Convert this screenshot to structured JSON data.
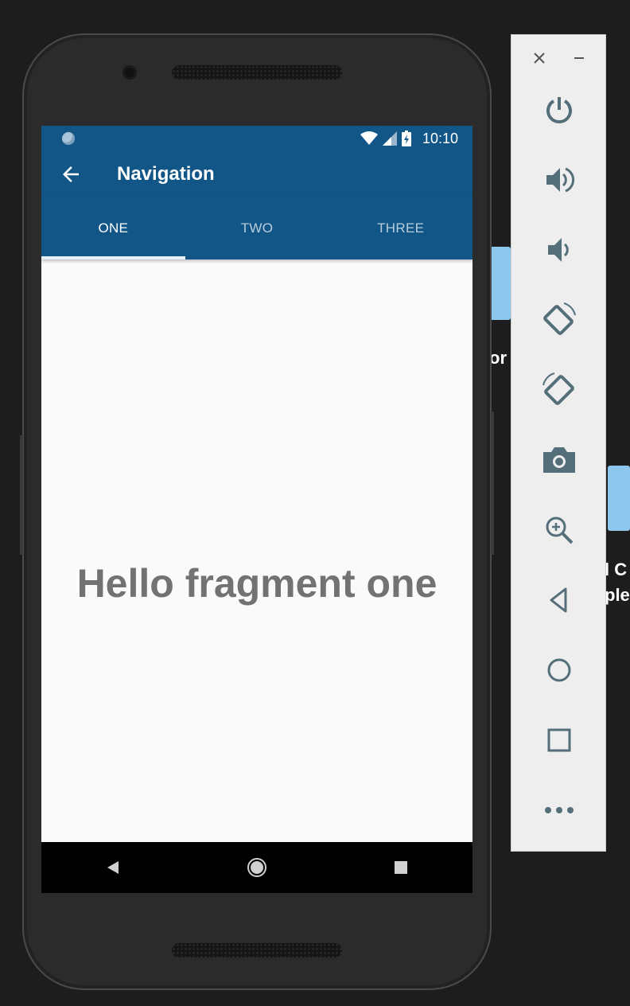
{
  "desktop": {
    "label_1": "or",
    "label_2_line1": "l C",
    "label_2_line2": "ple"
  },
  "status_bar": {
    "time": "10:10",
    "icons": [
      "wifi-icon",
      "signal-icon",
      "battery-charging-icon"
    ]
  },
  "app_bar": {
    "title": "Navigation",
    "back_icon": "arrow-back-icon"
  },
  "tabs": [
    {
      "label": "ONE",
      "selected": true
    },
    {
      "label": "TWO",
      "selected": false
    },
    {
      "label": "THREE",
      "selected": false
    }
  ],
  "content": {
    "text": "Hello fragment one"
  },
  "nav_bar": [
    "back-icon",
    "home-icon",
    "recents-icon"
  ],
  "emulator_toolbar": {
    "buttons": [
      "close-icon",
      "minimize-icon",
      "power-icon",
      "volume-up-icon",
      "volume-down-icon",
      "rotate-left-icon",
      "rotate-right-icon",
      "camera-icon",
      "zoom-icon",
      "back-icon",
      "home-icon",
      "overview-icon",
      "more-icon"
    ]
  },
  "colors": {
    "primary": "#125688",
    "background": "#fafafa",
    "toolbar_icon": "#546e7a"
  }
}
